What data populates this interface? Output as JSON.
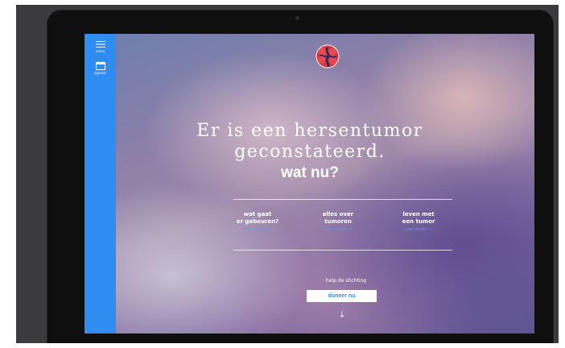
{
  "sidebar": {
    "menu_label": "menu",
    "agenda_label": "agenda"
  },
  "hero": {
    "headline_line1": "Er is een hersentumor",
    "headline_line2": "geconstateerd.",
    "subheadline": "wat nu?"
  },
  "sections": [
    {
      "title_line1": "wat gaat",
      "title_line2": "er gebeuren?",
      "link": "lees verder →"
    },
    {
      "title_line1": "alles over",
      "title_line2": "tumoren",
      "link": "lees verder →"
    },
    {
      "title_line1": "leven met",
      "title_line2": "een tumor",
      "link": "lees verder →"
    }
  ],
  "cta": {
    "help_text": "help de stichting",
    "donate_label": "doneer nu",
    "scroll_arrow": "↓"
  },
  "colors": {
    "accent": "#2f8df2",
    "logo_red": "#d8343a",
    "logo_navy": "#1f2a6b"
  },
  "icons": {
    "menu": "hamburger-icon",
    "agenda": "calendar-icon",
    "logo": "brain-logo"
  }
}
